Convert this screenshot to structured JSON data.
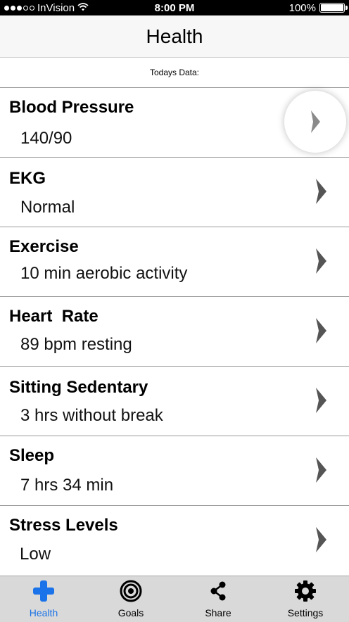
{
  "status_bar": {
    "carrier": "InVision",
    "time": "8:00 PM",
    "battery": "100%",
    "battery_level": 1.0
  },
  "nav": {
    "title": "Health"
  },
  "subheader": "Todays Data:",
  "items": [
    {
      "title": "Blood Pressure",
      "value": "140/90"
    },
    {
      "title": "EKG",
      "value": "Normal"
    },
    {
      "title": "Exercise",
      "value": "10 min aerobic activity"
    },
    {
      "title": "Heart  Rate",
      "value": "89 bpm resting"
    },
    {
      "title": "Sitting Sedentary",
      "value": "3 hrs without break"
    },
    {
      "title": "Sleep",
      "value": "7 hrs 34 min"
    },
    {
      "title": "Stress Levels",
      "value": "Low"
    }
  ],
  "tabs": [
    {
      "label": "Health",
      "icon": "plus-icon",
      "active": true
    },
    {
      "label": "Goals",
      "icon": "target-icon",
      "active": false
    },
    {
      "label": "Share",
      "icon": "share-icon",
      "active": false
    },
    {
      "label": "Settings",
      "icon": "gear-icon",
      "active": false
    }
  ],
  "colors": {
    "accent": "#1a73e8",
    "tab_bar": "#d9d9d9"
  }
}
